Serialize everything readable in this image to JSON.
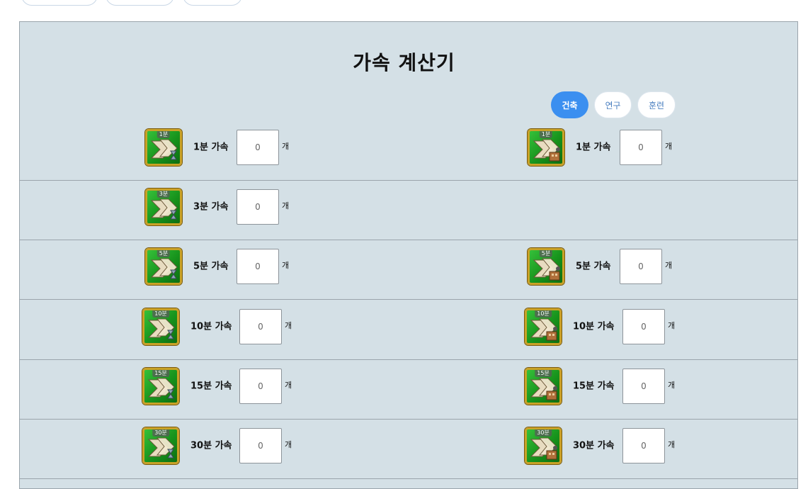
{
  "title": "가속 계산기",
  "tabs": [
    {
      "label": "건축",
      "active": true
    },
    {
      "label": "연구",
      "active": false
    },
    {
      "label": "훈련",
      "active": false
    }
  ],
  "unit": "개",
  "input_placeholder": "0",
  "colors": {
    "panel_bg": "#d4e0e6",
    "active_tab": "#3b8ff0",
    "icon_green": "#17931c",
    "icon_border": "#c9a227"
  },
  "rows": [
    {
      "left": {
        "badge": "1분",
        "label": "1분 가속",
        "value": "",
        "icon": "speedup-hourglass-icon"
      },
      "right": {
        "badge": "1분",
        "label": "1분 가속",
        "value": "",
        "icon": "speedup-building-icon"
      }
    },
    {
      "left": {
        "badge": "3분",
        "label": "3분 가속",
        "value": "",
        "icon": "speedup-hourglass-icon"
      }
    },
    {
      "left": {
        "badge": "5분",
        "label": "5분 가속",
        "value": "",
        "icon": "speedup-hourglass-icon"
      },
      "right": {
        "badge": "5분",
        "label": "5분 가속",
        "value": "",
        "icon": "speedup-building-icon"
      }
    },
    {
      "left": {
        "badge": "10분",
        "label": "10분 가속",
        "value": "",
        "icon": "speedup-hourglass-icon"
      },
      "right": {
        "badge": "10분",
        "label": "10분 가속",
        "value": "",
        "icon": "speedup-building-icon"
      }
    },
    {
      "left": {
        "badge": "15분",
        "label": "15분 가속",
        "value": "",
        "icon": "speedup-hourglass-icon"
      },
      "right": {
        "badge": "15분",
        "label": "15분 가속",
        "value": "",
        "icon": "speedup-building-icon"
      }
    },
    {
      "left": {
        "badge": "30분",
        "label": "30분 가속",
        "value": "",
        "icon": "speedup-hourglass-icon"
      },
      "right": {
        "badge": "30분",
        "label": "30분 가속",
        "value": "",
        "icon": "speedup-building-icon"
      }
    }
  ]
}
